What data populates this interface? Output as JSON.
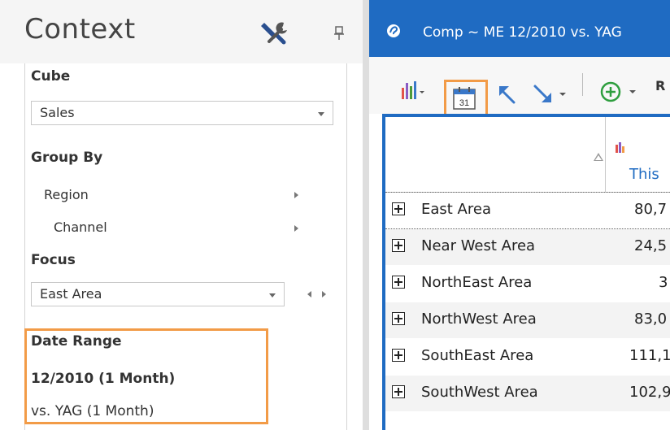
{
  "context": {
    "title": "Context",
    "cube": {
      "label": "Cube",
      "value": "Sales"
    },
    "group_by": {
      "label": "Group By",
      "items": [
        "Region",
        "Channel"
      ]
    },
    "focus": {
      "label": "Focus",
      "value": "East Area"
    },
    "date_range": {
      "label": "Date Range",
      "primary": "12/2010 (1 Month)",
      "comparison": "vs. YAG (1 Month)"
    }
  },
  "report": {
    "title": "Comp ~ ME 12/2010 vs. YAG",
    "toolbar": {
      "r_label": "R",
      "calendar_day": "31"
    },
    "header": {
      "col_label": "This"
    },
    "rows": [
      {
        "name": "East Area",
        "value": "80,7"
      },
      {
        "name": "Near West Area",
        "value": "24,5"
      },
      {
        "name": "NorthEast Area",
        "value": "3"
      },
      {
        "name": "NorthWest Area",
        "value": "83,0"
      },
      {
        "name": "SouthEast Area",
        "value": "111,1"
      },
      {
        "name": "SouthWest Area",
        "value": "102,9"
      }
    ]
  },
  "colors": {
    "accent": "#1f6bc2",
    "highlight": "#f29b47"
  }
}
